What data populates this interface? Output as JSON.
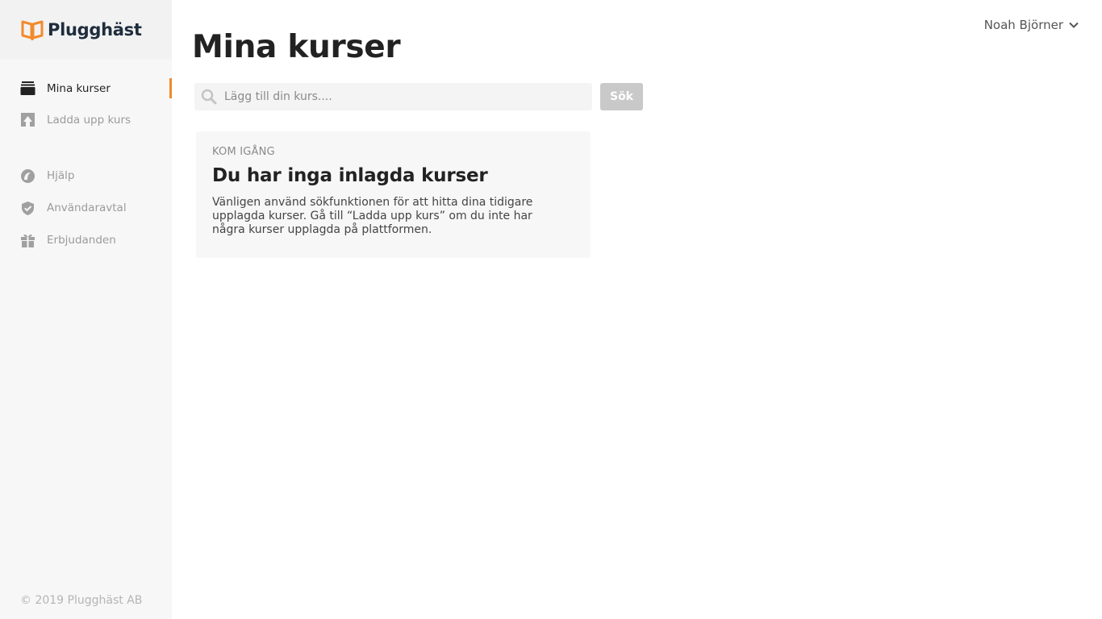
{
  "brand": {
    "name": "Plugghäst",
    "accent_color": "#f28a2b",
    "logo_color": "#f28a2b"
  },
  "sidebar": {
    "main_items": [
      {
        "label": "Mina kurser",
        "icon": "courses-stack-icon",
        "active": true
      },
      {
        "label": "Ladda upp kurs",
        "icon": "upload-icon",
        "active": false
      }
    ],
    "secondary_items": [
      {
        "label": "Hjälp",
        "icon": "help-bubble-icon"
      },
      {
        "label": "Användaravtal",
        "icon": "shield-check-icon"
      },
      {
        "label": "Erbjudanden",
        "icon": "gift-icon"
      }
    ],
    "copyright": "© 2019 Plugghäst AB"
  },
  "header": {
    "user_name": "Noah Björner"
  },
  "main": {
    "title": "Mina kurser",
    "search": {
      "placeholder": "Lägg till din kurs....",
      "value": "",
      "button_label": "Sök"
    },
    "empty_card": {
      "eyebrow": "KOM IGÅNG",
      "title": "Du har inga inlagda kurser",
      "body": "Vänligen använd sökfunktionen för att hitta dina tidigare upplagda kurser. Gå till “Ladda upp kurs” om du inte har några kurser upplagda på plattformen."
    }
  }
}
